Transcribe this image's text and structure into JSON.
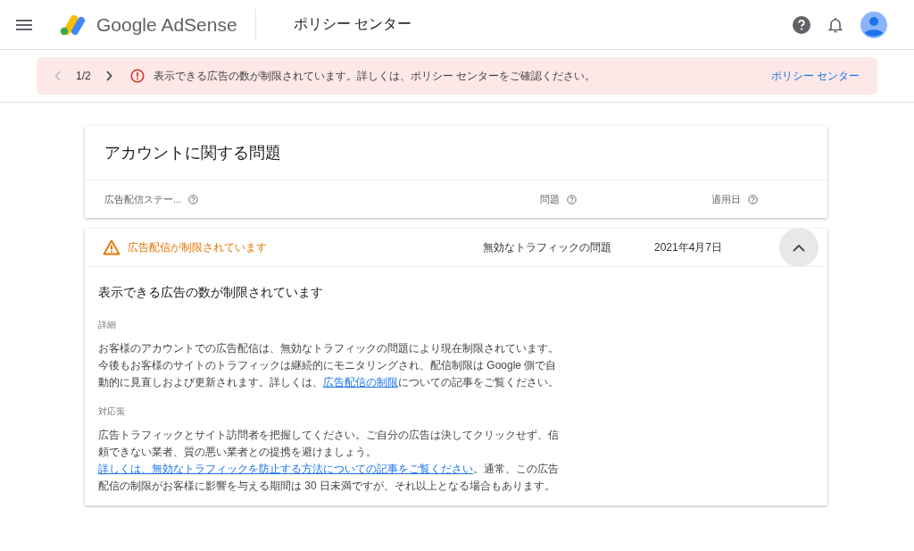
{
  "header": {
    "brand": "Google AdSense",
    "title": "ポリシー センター"
  },
  "banner": {
    "pager": "1/2",
    "message": "表示できる広告の数が制限されています。詳しくは、ポリシー センターをご確認ください。",
    "link": "ポリシー センター"
  },
  "card": {
    "title": "アカウントに関する問題",
    "columns": [
      "広告配信ステー...",
      "問題",
      "適用日"
    ]
  },
  "issue": {
    "status": "広告配信が制限されています",
    "problem": "無効なトラフィックの問題",
    "date": "2021年4月7日",
    "expanded": true,
    "heading": "表示できる広告の数が制限されています",
    "sections": [
      {
        "label": "詳細",
        "before": "お客様のアカウントでの広告配信は、無効なトラフィックの問題により現在制限されています。今後もお客様のサイトのトラフィックは継続的にモニタリングされ、配信制限は Google 側で自動的に見直しおよび更新されます。詳しくは、",
        "link": "広告配信の制限",
        "after": "についての記事をご覧ください。"
      },
      {
        "label": "対応策",
        "before": "広告トラフィックとサイト訪問者を把握してください。ご自分の広告は決してクリックせず、信頼できない業者、質の悪い業者との提携を避けましょう。",
        "link": "詳しくは、無効なトラフィックを防止する方法についての記事をご覧ください",
        "after": "。通常、この広告配信の制限がお客様に影響を与える期間は 30 日未満ですが、それ以上となる場合もあります。"
      }
    ]
  }
}
